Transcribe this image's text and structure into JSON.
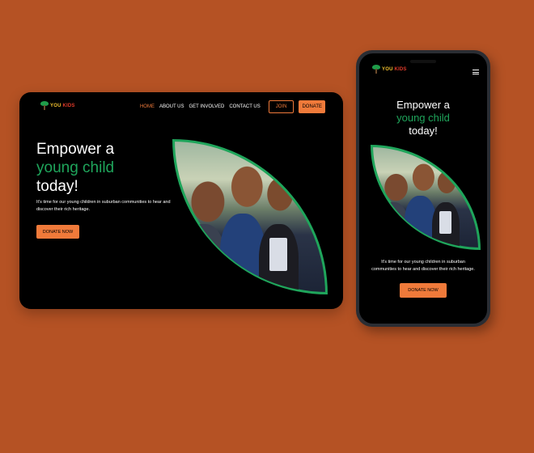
{
  "brand": {
    "logo_top": "YOU",
    "logo_bottom": "KIDS"
  },
  "nav": {
    "items": [
      "HOME",
      "ABOUT US",
      "GET INVOLVED",
      "CONTACT US"
    ],
    "join": "JOIN",
    "donate": "DONATE"
  },
  "hero": {
    "line1": "Empower a",
    "line2": "young child",
    "line3": "today!",
    "text": "It's time for our young children in suburban communities to hear and discover their rich heritage.",
    "button": "DONATE NOW"
  },
  "colors": {
    "accent": "#f07a3a",
    "green": "#1fa55b",
    "background": "#b55224"
  },
  "icons": {
    "menu": "hamburger-menu-icon",
    "logo": "tree-logo-icon"
  }
}
